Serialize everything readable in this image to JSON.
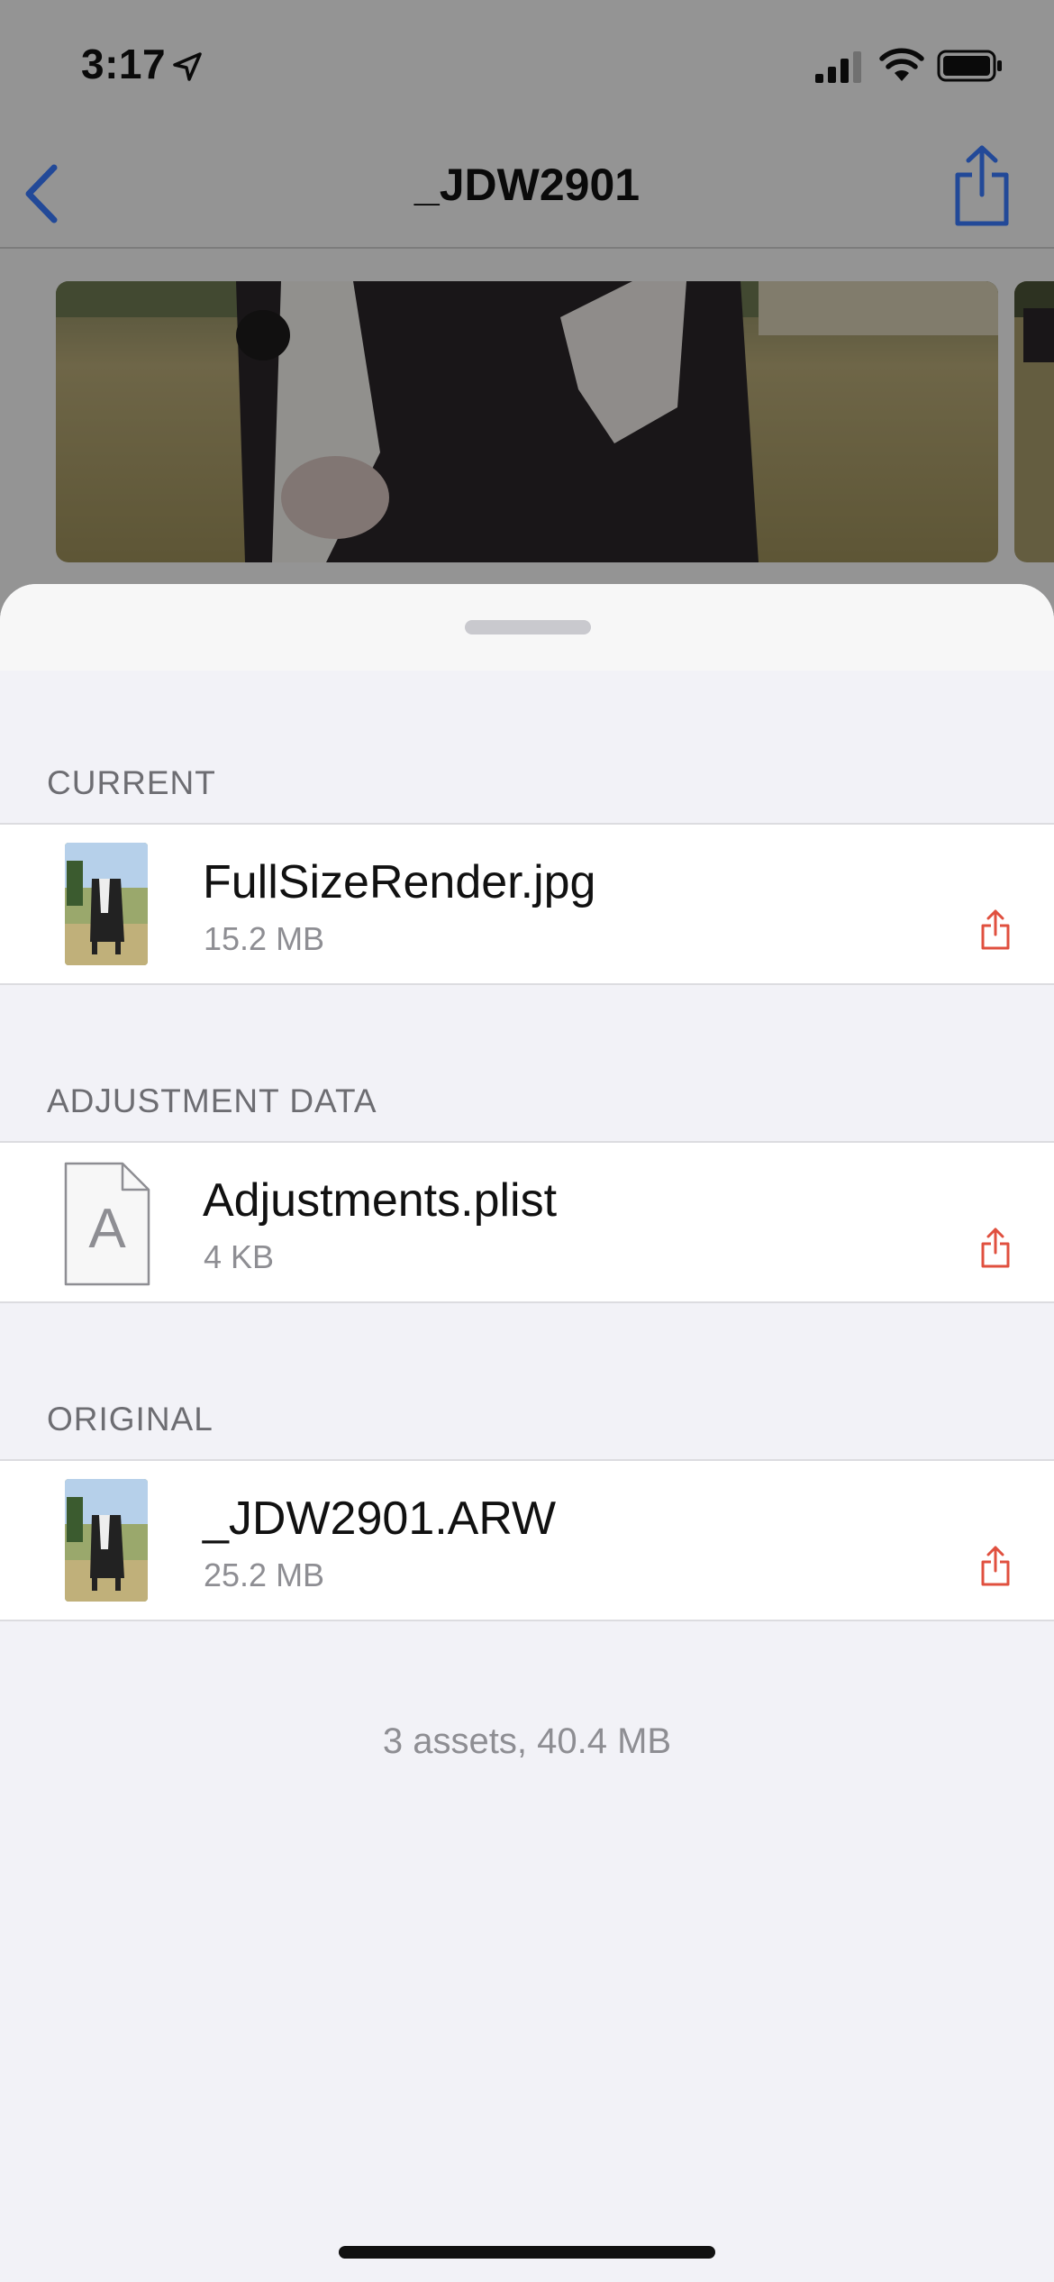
{
  "status_bar": {
    "time": "3:17"
  },
  "nav": {
    "title": "_JDW2901"
  },
  "sheet": {
    "sections": [
      {
        "header": "CURRENT",
        "item": {
          "name": "FullSizeRender.jpg",
          "size": "15.2 MB",
          "icon": "photo-thumbnail"
        }
      },
      {
        "header": "ADJUSTMENT DATA",
        "item": {
          "name": "Adjustments.plist",
          "size": "4 KB",
          "icon": "document-icon",
          "icon_letter": "A"
        }
      },
      {
        "header": "ORIGINAL",
        "item": {
          "name": "_JDW2901.ARW",
          "size": "25.2 MB",
          "icon": "photo-thumbnail"
        }
      }
    ],
    "summary": "3 assets, 40.4 MB"
  },
  "colors": {
    "accent": "#e0503f",
    "secondary_text": "#8e8e93",
    "section_header": "#6d6d72",
    "sheet_background": "#f2f2f7"
  }
}
